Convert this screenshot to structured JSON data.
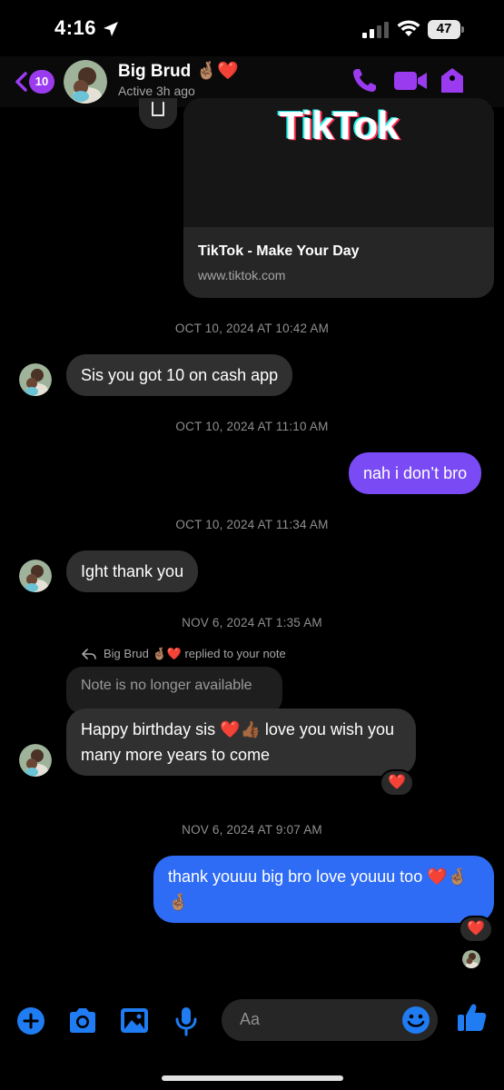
{
  "status_bar": {
    "time": "4:16",
    "battery": "47"
  },
  "header": {
    "back_badge": "10",
    "contact_name": "Big Brud 🤞🏽❤️",
    "contact_status": "Active 3h ago",
    "accent_color": "#9b3bf0"
  },
  "link_card": {
    "logo_text": "TikTok",
    "title": "TikTok - Make Your Day",
    "url": "www.tiktok.com"
  },
  "timestamps": [
    "OCT 10, 2024 AT 10:42 AM",
    "OCT 10, 2024 AT 11:10 AM",
    "OCT 10, 2024 AT 11:34 AM",
    "NOV 6, 2024 AT 1:35 AM",
    "NOV 6, 2024 AT 9:07 AM"
  ],
  "messages": [
    {
      "from": "them",
      "text": "Sis you got 10 on cash app"
    },
    {
      "from": "me",
      "text": "nah i don’t bro"
    },
    {
      "from": "them",
      "text": "Ight thank you"
    },
    {
      "from": "them",
      "text": "Happy birthday sis ❤️👍🏾 love you wish you many more years to come",
      "reaction": "❤️"
    },
    {
      "from": "me",
      "text": "thank youuu big bro love youuu too ❤️🤞🏽🤞🏽",
      "reaction": "❤️"
    }
  ],
  "reply_note": {
    "label": "Big Brud 🤞🏽❤️ replied to your note",
    "note_text": "Note is no longer available"
  },
  "composer": {
    "placeholder": "Aa"
  },
  "colors": {
    "incoming_bubble": "#303030",
    "outgoing_purple": "#7a4bf4",
    "outgoing_blue": "#2e6cf6",
    "composer_icon": "#1f7cf2"
  }
}
